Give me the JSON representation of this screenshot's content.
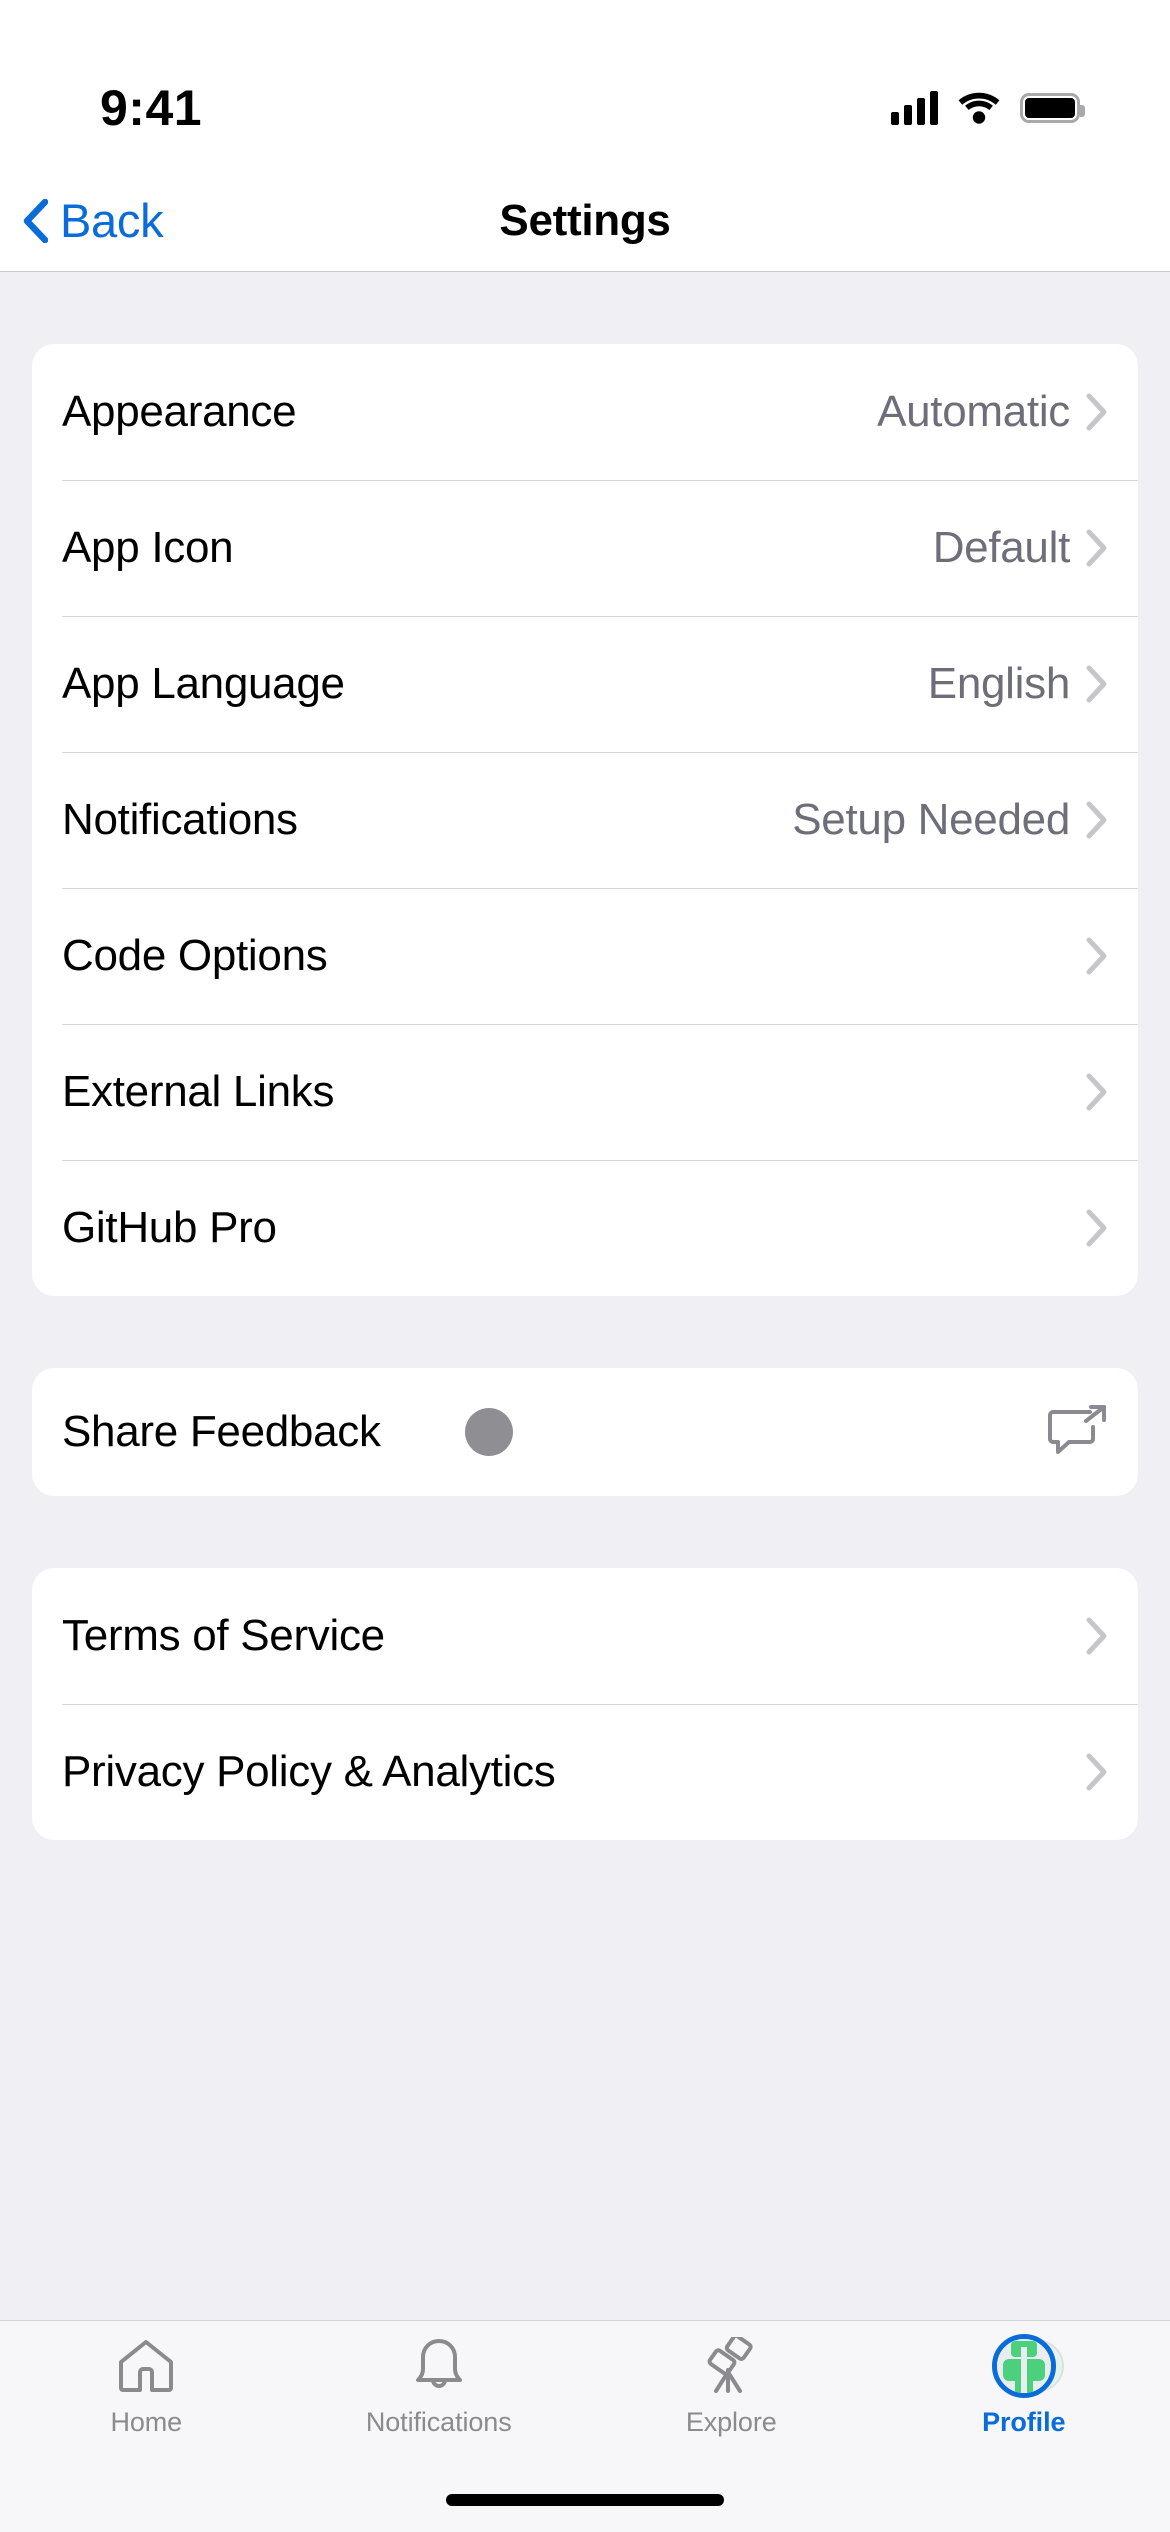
{
  "status_bar": {
    "time": "9:41",
    "cellular_icon": "cellular-signal-icon",
    "wifi_icon": "wifi-icon",
    "battery_icon": "battery-full-icon"
  },
  "nav_bar": {
    "back_label": "Back",
    "back_icon": "chevron-left-icon",
    "title": "Settings",
    "accent_color": "#0A6CD8"
  },
  "sections": [
    {
      "id": "preferences",
      "rows": [
        {
          "label": "Appearance",
          "value": "Automatic",
          "accessory": "chevron-right-icon"
        },
        {
          "label": "App Icon",
          "value": "Default",
          "accessory": "chevron-right-icon"
        },
        {
          "label": "App Language",
          "value": "English",
          "accessory": "chevron-right-icon"
        },
        {
          "label": "Notifications",
          "value": "Setup Needed",
          "accessory": "chevron-right-icon"
        },
        {
          "label": "Code Options",
          "value": "",
          "accessory": "chevron-right-icon"
        },
        {
          "label": "External Links",
          "value": "",
          "accessory": "chevron-right-icon"
        },
        {
          "label": "GitHub Pro",
          "value": "",
          "accessory": "chevron-right-icon"
        }
      ]
    },
    {
      "id": "feedback",
      "rows": [
        {
          "label": "Share Feedback",
          "value": "",
          "accessory": "share-comment-icon",
          "badge": "avatar-dot"
        }
      ]
    },
    {
      "id": "legal",
      "rows": [
        {
          "label": "Terms of Service",
          "value": "",
          "accessory": "chevron-right-icon"
        },
        {
          "label": "Privacy Policy & Analytics",
          "value": "",
          "accessory": "chevron-right-icon"
        }
      ]
    }
  ],
  "tab_bar": {
    "items": [
      {
        "label": "Home",
        "icon": "house-icon",
        "active": false
      },
      {
        "label": "Notifications",
        "icon": "bell-icon",
        "active": false
      },
      {
        "label": "Explore",
        "icon": "telescope-icon",
        "active": false
      },
      {
        "label": "Profile",
        "icon": "avatar-icon",
        "active": true
      }
    ],
    "active_color": "#0A6CD8",
    "inactive_color": "#8A8A8F"
  },
  "colors": {
    "background": "#EFEFF4",
    "card": "#FFFFFF",
    "value_text": "#6E6E78",
    "chevron": "#C5C5CA",
    "separator": "#D8D8DC",
    "avatar_dot": "#8E8E93",
    "profile_green": "#4BD07E"
  }
}
